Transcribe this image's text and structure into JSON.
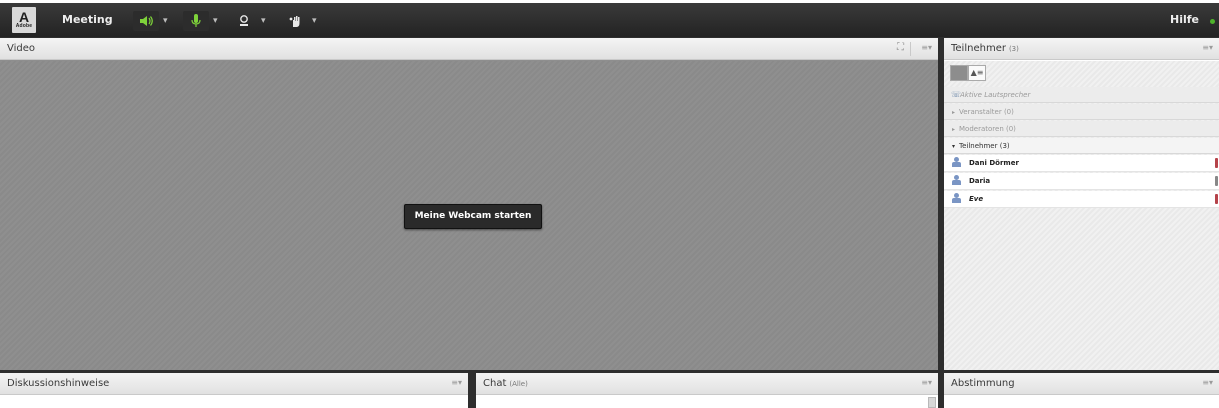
{
  "app": {
    "logo_text": "A",
    "logo_sub": "Adobe",
    "menu_meeting": "Meeting",
    "help": "Hilfe",
    "colors": {
      "active_green": "#7ed23a",
      "topbar": "#2b2b2b"
    }
  },
  "toolbar": {
    "speaker_icon": "speaker-icon",
    "mic_icon": "microphone-icon",
    "webcam_icon": "webcam-icon",
    "raise_hand_icon": "raise-hand-icon",
    "caret": "▾"
  },
  "video_pod": {
    "title": "Video",
    "menu": "≡▾",
    "start_webcam_button": "Meine Webcam starten"
  },
  "attendees_pod": {
    "title": "Teilnehmer",
    "count": "(3)",
    "menu": "≡▾",
    "active_speakers": "Aktive Lautsprecher",
    "categories": [
      {
        "label": "Veranstalter (0)",
        "expanded": false
      },
      {
        "label": "Moderatoren (0)",
        "expanded": false
      },
      {
        "label": "Teilnehmer (3)",
        "expanded": true
      }
    ],
    "people": [
      {
        "name": "Dani Dörmer",
        "mic": "red"
      },
      {
        "name": "Daria",
        "mic": "gray"
      },
      {
        "name": "Eve",
        "mic": "red"
      }
    ]
  },
  "notes_pod": {
    "title": "Diskussionshinweise",
    "menu": "≡▾"
  },
  "chat_pod": {
    "title": "Chat",
    "scope": "(Alle)",
    "menu": "≡▾"
  },
  "poll_pod": {
    "title": "Abstimmung",
    "menu": "≡▾"
  }
}
